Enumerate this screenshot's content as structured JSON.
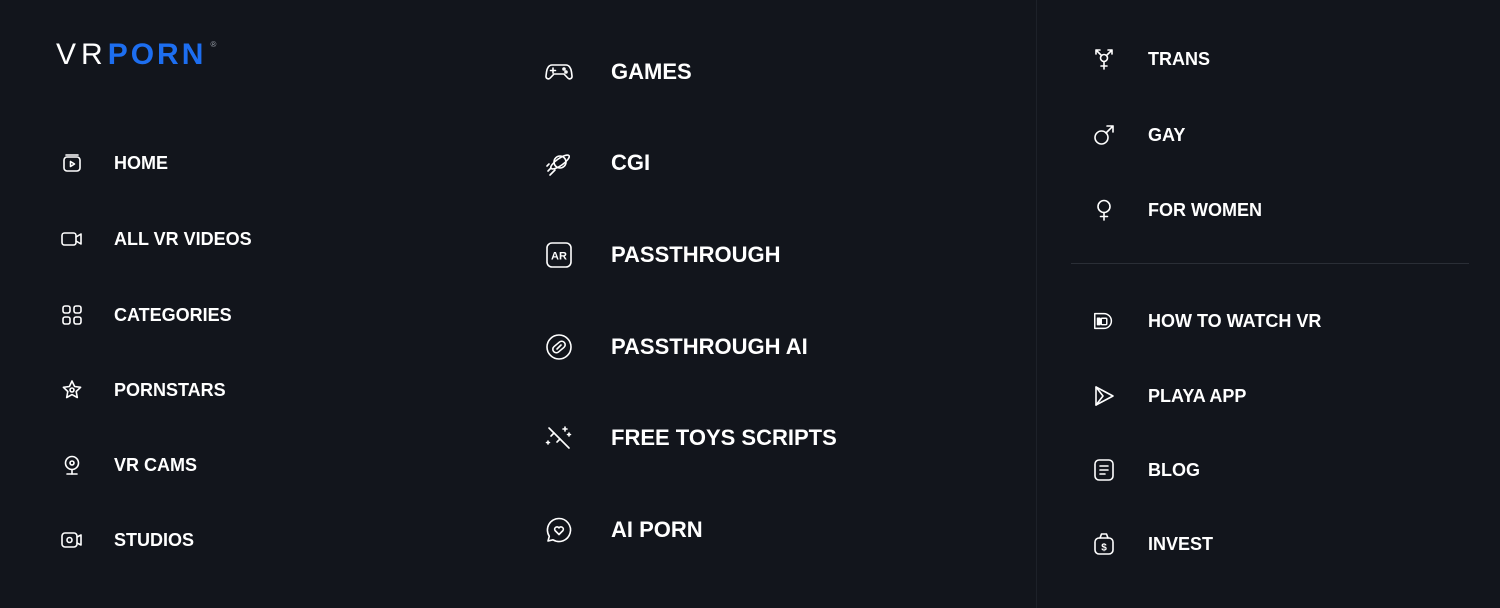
{
  "logo": {
    "part1": "VR",
    "part2": "PORN",
    "reg": "®"
  },
  "left_nav": [
    {
      "label": "HOME",
      "icon": "home-play-icon"
    },
    {
      "label": "ALL VR VIDEOS",
      "icon": "video-camera-icon"
    },
    {
      "label": "CATEGORIES",
      "icon": "grid-icon"
    },
    {
      "label": "PORNSTARS",
      "icon": "star-badge-icon"
    },
    {
      "label": "VR CAMS",
      "icon": "webcam-icon"
    },
    {
      "label": "STUDIOS",
      "icon": "studio-icon"
    }
  ],
  "mid_nav": [
    {
      "label": "GAMES",
      "icon": "gamepad-icon"
    },
    {
      "label": "CGI",
      "icon": "planet-icon"
    },
    {
      "label": "PASSTHROUGH",
      "icon": "ar-icon",
      "icon_text": "AR"
    },
    {
      "label": "PASSTHROUGH AI",
      "icon": "passthrough-ai-icon"
    },
    {
      "label": "FREE TOYS SCRIPTS",
      "icon": "magic-wand-icon"
    },
    {
      "label": "AI PORN",
      "icon": "chat-heart-icon"
    }
  ],
  "right_nav_top": [
    {
      "label": "TRANS",
      "icon": "transgender-icon"
    },
    {
      "label": "GAY",
      "icon": "male-symbol-icon"
    },
    {
      "label": "FOR WOMEN",
      "icon": "female-symbol-icon"
    }
  ],
  "right_nav_bottom": [
    {
      "label": "HOW TO WATCH VR",
      "icon": "vr-headset-icon"
    },
    {
      "label": "PLAYA APP",
      "icon": "play-app-icon"
    },
    {
      "label": "BLOG",
      "icon": "document-icon"
    },
    {
      "label": "INVEST",
      "icon": "money-bag-icon",
      "icon_text": "$"
    }
  ],
  "colors": {
    "background": "#12151c",
    "accent": "#1d6ef0",
    "text": "#ffffff"
  }
}
